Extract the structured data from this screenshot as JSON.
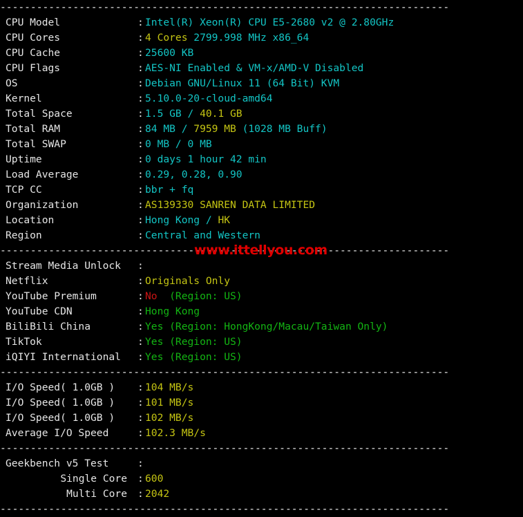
{
  "terminal": {
    "title": "VPS Benchmark Script Output",
    "separator_line": "--------------------------------------------------------------------------",
    "colon": ":",
    "watermark": "www.ittellyou.com",
    "watermark_color": "#e00000",
    "colors": {
      "background": "#000000",
      "label": "#e6e6e6",
      "cyan": "#13c5c5",
      "yellow": "#c5c513",
      "green": "#13b513",
      "red": "#cc1414"
    }
  },
  "system_info": [
    {
      "label": "CPU Model",
      "value_parts": [
        {
          "text": "Intel(R) Xeon(R) CPU E5-2680 v2 @ 2.80GHz",
          "color": "cy"
        }
      ],
      "value_plain": "Intel(R) Xeon(R) CPU E5-2680 v2 @ 2.80GHz"
    },
    {
      "label": "CPU Cores",
      "value_parts": [
        {
          "text": "4 Cores ",
          "color": "ye"
        },
        {
          "text": "2799.998 MHz x86_64",
          "color": "cy"
        }
      ],
      "value_plain": "4 Cores 2799.998 MHz x86_64"
    },
    {
      "label": "CPU Cache",
      "value_parts": [
        {
          "text": "25600 KB",
          "color": "cy"
        }
      ],
      "value_plain": "25600 KB"
    },
    {
      "label": "CPU Flags",
      "value_parts": [
        {
          "text": "AES-NI Enabled & VM-x/AMD-V Disabled",
          "color": "cy"
        }
      ],
      "value_plain": "AES-NI Enabled & VM-x/AMD-V Disabled"
    },
    {
      "label": "OS",
      "value_parts": [
        {
          "text": "Debian GNU/Linux 11 (64 Bit) KVM",
          "color": "cy"
        }
      ],
      "value_plain": "Debian GNU/Linux 11 (64 Bit) KVM"
    },
    {
      "label": "Kernel",
      "value_parts": [
        {
          "text": "5.10.0-20-cloud-amd64",
          "color": "cy"
        }
      ],
      "value_plain": "5.10.0-20-cloud-amd64"
    },
    {
      "label": "Total Space",
      "value_parts": [
        {
          "text": "1.5 GB / ",
          "color": "cy"
        },
        {
          "text": "40.1 GB",
          "color": "ye"
        }
      ],
      "value_plain": "1.5 GB / 40.1 GB"
    },
    {
      "label": "Total RAM",
      "value_parts": [
        {
          "text": "84 MB / ",
          "color": "cy"
        },
        {
          "text": "7959 MB ",
          "color": "ye"
        },
        {
          "text": "(1028 MB Buff)",
          "color": "cy"
        }
      ],
      "value_plain": "84 MB / 7959 MB (1028 MB Buff)"
    },
    {
      "label": "Total SWAP",
      "value_parts": [
        {
          "text": "0 MB / 0 MB",
          "color": "cy"
        }
      ],
      "value_plain": "0 MB / 0 MB"
    },
    {
      "label": "Uptime",
      "value_parts": [
        {
          "text": "0 days 1 hour 42 min",
          "color": "cy"
        }
      ],
      "value_plain": "0 days 1 hour 42 min"
    },
    {
      "label": "Load Average",
      "value_parts": [
        {
          "text": "0.29, 0.28, 0.90",
          "color": "cy"
        }
      ],
      "value_plain": "0.29, 0.28, 0.90"
    },
    {
      "label": "TCP CC",
      "value_parts": [
        {
          "text": "bbr + fq",
          "color": "cy"
        }
      ],
      "value_plain": "bbr + fq"
    },
    {
      "label": "Organization",
      "value_parts": [
        {
          "text": "AS139330 SANREN DATA LIMITED",
          "color": "ye"
        }
      ],
      "value_plain": "AS139330 SANREN DATA LIMITED"
    },
    {
      "label": "Location",
      "value_parts": [
        {
          "text": "Hong Kong / ",
          "color": "cy"
        },
        {
          "text": "HK",
          "color": "ye"
        }
      ],
      "value_plain": "Hong Kong / HK"
    },
    {
      "label": "Region",
      "value_parts": [
        {
          "text": "Central and Western",
          "color": "cy"
        }
      ],
      "value_plain": "Central and Western"
    }
  ],
  "stream_media": {
    "header_label": "Stream Media Unlock",
    "header_value": "",
    "items": [
      {
        "label": "Netflix",
        "value_parts": [
          {
            "text": "Originals Only",
            "color": "ye"
          }
        ],
        "value_plain": "Originals Only"
      },
      {
        "label": "YouTube Premium",
        "value_parts": [
          {
            "text": "No ",
            "color": "rd"
          },
          {
            "text": " (Region: US)",
            "color": "gr"
          }
        ],
        "value_plain": "No  (Region: US)"
      },
      {
        "label": "YouTube CDN",
        "value_parts": [
          {
            "text": "Hong Kong",
            "color": "gr"
          }
        ],
        "value_plain": "Hong Kong"
      },
      {
        "label": "BiliBili China",
        "value_parts": [
          {
            "text": "Yes (Region: HongKong/Macau/Taiwan Only)",
            "color": "gr"
          }
        ],
        "value_plain": "Yes (Region: HongKong/Macau/Taiwan Only)"
      },
      {
        "label": "TikTok",
        "value_parts": [
          {
            "text": "Yes (Region: US)",
            "color": "gr"
          }
        ],
        "value_plain": "Yes (Region: US)"
      },
      {
        "label": "iQIYI International",
        "value_parts": [
          {
            "text": "Yes (Region: US)",
            "color": "gr"
          }
        ],
        "value_plain": "Yes (Region: US)"
      }
    ]
  },
  "io_speed": [
    {
      "label": "I/O Speed( 1.0GB )",
      "value_parts": [
        {
          "text": "104 MB/s",
          "color": "ye"
        }
      ],
      "value_plain": "104 MB/s"
    },
    {
      "label": "I/O Speed( 1.0GB )",
      "value_parts": [
        {
          "text": "101 MB/s",
          "color": "ye"
        }
      ],
      "value_plain": "101 MB/s"
    },
    {
      "label": "I/O Speed( 1.0GB )",
      "value_parts": [
        {
          "text": "102 MB/s",
          "color": "ye"
        }
      ],
      "value_plain": "102 MB/s"
    },
    {
      "label": "Average I/O Speed",
      "value_parts": [
        {
          "text": "102.3 MB/s",
          "color": "ye"
        }
      ],
      "value_plain": "102.3 MB/s"
    }
  ],
  "geekbench": {
    "header_label": "Geekbench v5 Test",
    "header_value": "",
    "items": [
      {
        "label": "Single Core",
        "indent": true,
        "value_parts": [
          {
            "text": "600",
            "color": "ye"
          }
        ],
        "value_plain": "600"
      },
      {
        "label": "Multi Core",
        "indent": true,
        "value_parts": [
          {
            "text": "2042",
            "color": "ye"
          }
        ],
        "value_plain": "2042"
      }
    ]
  }
}
